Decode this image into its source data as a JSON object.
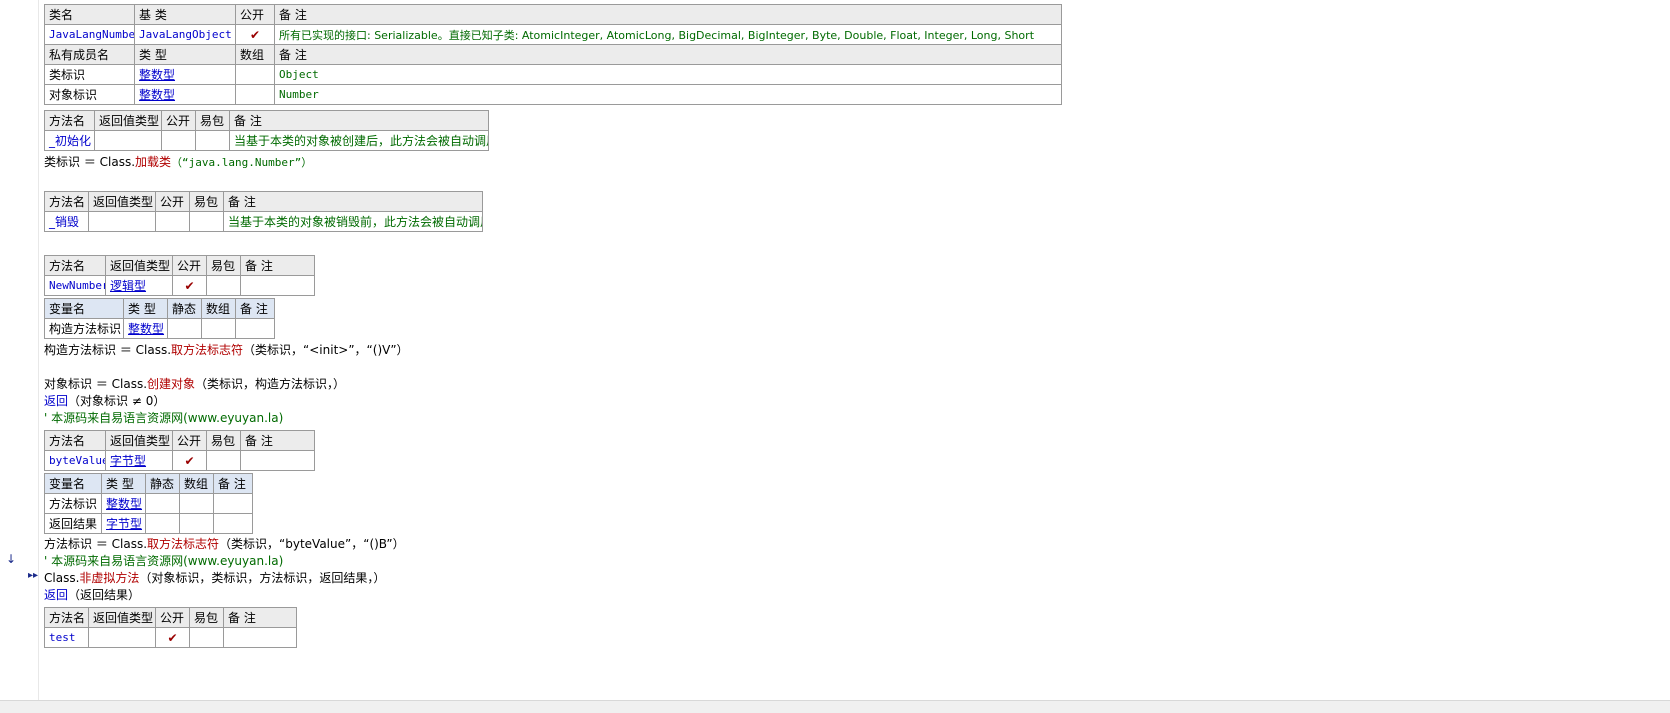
{
  "class_table": {
    "headers": [
      "类名",
      "基 类",
      "公开",
      "备 注"
    ],
    "row": {
      "name": "JavaLangNumber",
      "base": "JavaLangObject",
      "public": "✔",
      "note": "所有已实现的接口: Serializable。直接已知子类: AtomicInteger, AtomicLong, BigDecimal, BigInteger, Byte, Double, Float, Integer, Long, Short"
    },
    "member_headers": [
      "私有成员名",
      "类 型",
      "数组",
      "备 注"
    ],
    "members": [
      {
        "name": "类标识",
        "type": "整数型",
        "array": "",
        "note": "Object"
      },
      {
        "name": "对象标识",
        "type": "整数型",
        "array": "",
        "note": "Number"
      }
    ]
  },
  "method_headers": [
    "方法名",
    "返回值类型",
    "公开",
    "易包",
    "备 注"
  ],
  "var_headers": [
    "变量名",
    "类 型",
    "静态",
    "数组",
    "备 注"
  ],
  "init_method": {
    "name": "_初始化",
    "note": "当基于本类的对象被创建后，此方法会被自动调用"
  },
  "init_code": {
    "lhs": "类标识 ＝ Class.",
    "func": "加载类",
    "args": "（“java.lang.Number”）"
  },
  "destroy_method": {
    "name": "_销毁",
    "note": "当基于本类的对象被销毁前，此方法会被自动调用"
  },
  "newnumber_method": {
    "name": "NewNumber",
    "ret": "逻辑型",
    "public": "✔"
  },
  "newnumber_vars": [
    {
      "name": "构造方法标识",
      "type": "整数型"
    }
  ],
  "newnumber_code": {
    "l1_lhs": "构造方法标识 ＝ Class.",
    "l1_func": "取方法标志符",
    "l1_args": "（类标识，“<init>”，“()V”）",
    "l2_lhs": "对象标识 ＝ Class.",
    "l2_func": "创建对象",
    "l2_args": "（类标识，构造方法标识，）",
    "l3_kw": "返回",
    "l3_args": "（对象标识 ≠ 0）",
    "l4_comment": "' 本源码来自易语言资源网(www.eyuyan.la)"
  },
  "bytevalue_method": {
    "name": "byteValue",
    "ret": "字节型",
    "public": "✔"
  },
  "bytevalue_vars": [
    {
      "name": "方法标识",
      "type": "整数型"
    },
    {
      "name": "返回结果",
      "type": "字节型"
    }
  ],
  "bytevalue_code": {
    "l1_lhs": "方法标识 ＝ Class.",
    "l1_func": "取方法标志符",
    "l1_args": "（类标识，“byteValue”，“()B”）",
    "l2_comment": "' 本源码来自易语言资源网(www.eyuyan.la)",
    "l3_lhs": "Class.",
    "l3_func": "非虚拟方法",
    "l3_args": "（对象标识，类标识，方法标识，返回结果，）",
    "l4_kw": "返回",
    "l4_args": "（返回结果）"
  },
  "test_method": {
    "name": "test",
    "public": "✔"
  },
  "gutter": {
    "arrow_down": "↓",
    "exec_marker": "⇥"
  }
}
